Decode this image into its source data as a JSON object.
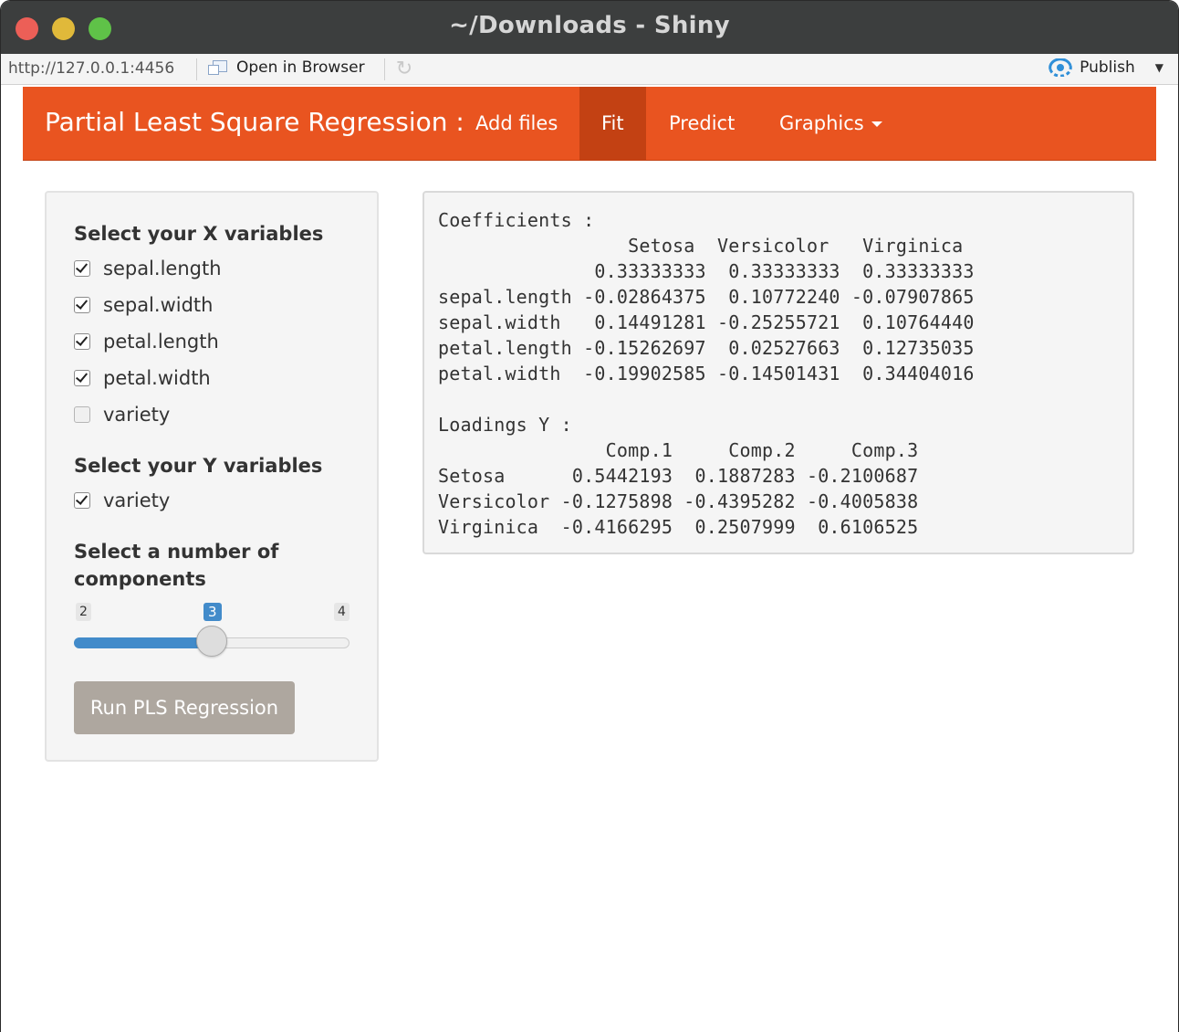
{
  "window": {
    "title": "~/Downloads - Shiny"
  },
  "addressbar": {
    "url": "http://127.0.0.1:4456",
    "open_in_browser": "Open in Browser",
    "publish": "Publish"
  },
  "navbar": {
    "brand": "Partial Least Square Regression :",
    "items": [
      {
        "label": "Add files"
      },
      {
        "label": "Fit"
      },
      {
        "label": "Predict"
      },
      {
        "label": "Graphics"
      }
    ],
    "active": "Fit"
  },
  "sidebar": {
    "x_label": "Select your X variables",
    "x_options": [
      {
        "label": "sepal.length",
        "checked": true
      },
      {
        "label": "sepal.width",
        "checked": true
      },
      {
        "label": "petal.length",
        "checked": true
      },
      {
        "label": "petal.width",
        "checked": true
      },
      {
        "label": "variety",
        "checked": false
      }
    ],
    "y_label": "Select your Y variables",
    "y_options": [
      {
        "label": "variety",
        "checked": true
      }
    ],
    "components_label_line1": "Select a number of",
    "components_label_line2": "components",
    "slider": {
      "min": "2",
      "max": "4",
      "value": "3"
    },
    "run_button": "Run PLS Regression"
  },
  "output": {
    "lines": [
      "Coefficients :",
      "                 Setosa  Versicolor   Virginica",
      "              0.33333333  0.33333333  0.33333333",
      "sepal.length -0.02864375  0.10772240 -0.07907865",
      "sepal.width   0.14491281 -0.25255721  0.10764440",
      "petal.length -0.15262697  0.02527663  0.12735035",
      "petal.width  -0.19902585 -0.14501431  0.34404016",
      "",
      "Loadings Y :",
      "               Comp.1     Comp.2     Comp.3",
      "Setosa      0.5442193  0.1887283 -0.2100687",
      "Versicolor -0.1275898 -0.4395282 -0.4005838",
      "Virginica  -0.4166295  0.2507999  0.6106525"
    ]
  }
}
